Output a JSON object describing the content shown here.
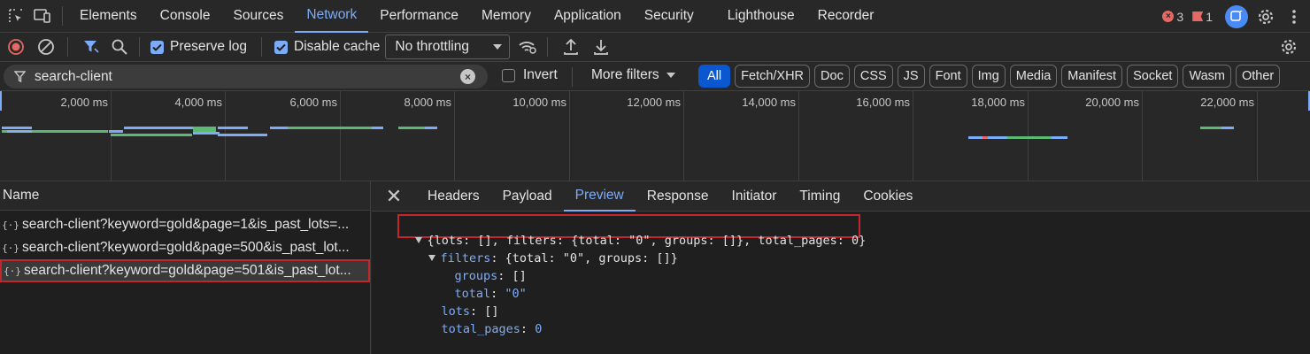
{
  "tabs": [
    "Elements",
    "Console",
    "Sources",
    "Network",
    "Performance",
    "Memory",
    "Application",
    "Security",
    "Lighthouse",
    "Recorder"
  ],
  "active_tab": "Network",
  "status": {
    "errors": "3",
    "warnings": "1"
  },
  "toolbar": {
    "preserve_log": "Preserve log",
    "disable_cache": "Disable cache",
    "throttling": "No throttling"
  },
  "filter": {
    "search_value": "search-client",
    "invert_label": "Invert",
    "more_filters": "More filters",
    "types": [
      "All",
      "Fetch/XHR",
      "Doc",
      "CSS",
      "JS",
      "Font",
      "Img",
      "Media",
      "Manifest",
      "Socket",
      "Wasm",
      "Other"
    ]
  },
  "timeline": {
    "ticks": [
      "2,000 ms",
      "4,000 ms",
      "6,000 ms",
      "8,000 ms",
      "10,000 ms",
      "12,000 ms",
      "14,000 ms",
      "16,000 ms",
      "18,000 ms",
      "20,000 ms",
      "22,000 ms"
    ]
  },
  "requests": {
    "header": "Name",
    "rows": [
      "search-client?keyword=gold&page=1&is_past_lots=...",
      "search-client?keyword=gold&page=500&is_past_lot...",
      "search-client?keyword=gold&page=501&is_past_lot..."
    ]
  },
  "details": {
    "tabs": [
      "Headers",
      "Payload",
      "Preview",
      "Response",
      "Initiator",
      "Timing",
      "Cookies"
    ],
    "active_tab": "Preview",
    "preview": {
      "summary": "{lots: [], filters: {total: \"0\", groups: []}, total_pages: 0}",
      "filters_key": "filters",
      "filters_value": ": {total: \"0\", groups: []}",
      "groups_key": "groups",
      "groups_value": ": []",
      "total_key": "total",
      "total_sep": ": ",
      "total_value": "\"0\"",
      "lots_key": "lots",
      "lots_value": ": []",
      "total_pages_key": "total_pages",
      "total_pages_sep": ": ",
      "total_pages_value": "0"
    }
  },
  "colors": {
    "accent": "#7cacf8",
    "error": "#e46962",
    "highlight_border": "#c0282d",
    "chip_active": "#0b57d0"
  }
}
